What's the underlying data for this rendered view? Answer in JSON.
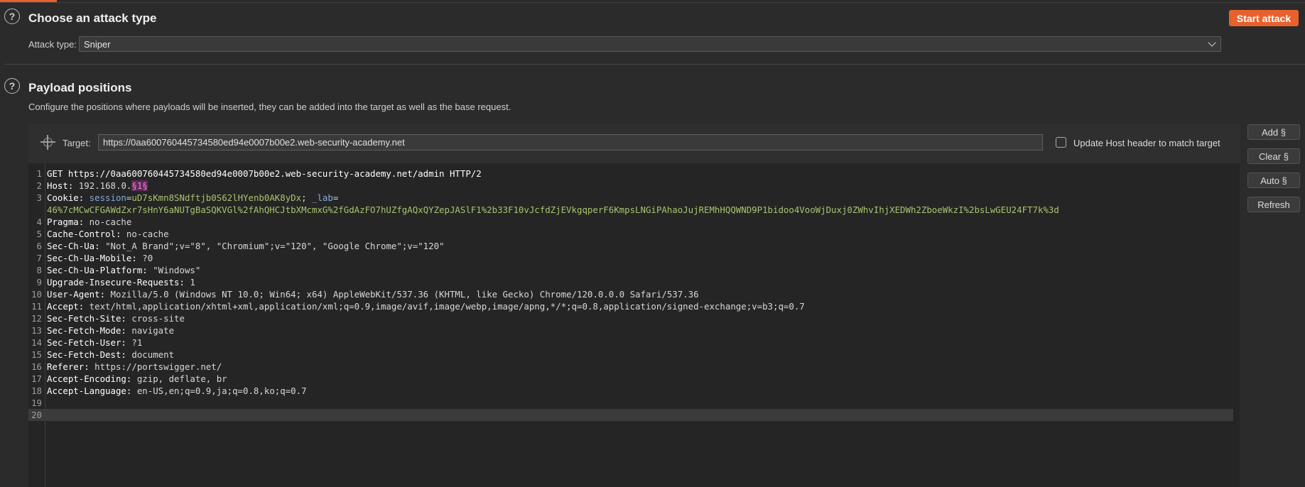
{
  "attack_type_section": {
    "title": "Choose an attack type",
    "attack_type_label": "Attack type:",
    "attack_type_value": "Sniper",
    "start_button": "Start attack"
  },
  "payload_section": {
    "title": "Payload positions",
    "description": "Configure the positions where payloads will be inserted, they can be added into the target as well as the base request.",
    "target_label": "Target:",
    "target_value": "https://0aa600760445734580ed94e0007b00e2.web-security-academy.net",
    "update_host_label": "Update Host header to match target",
    "side_buttons": [
      "Add §",
      "Clear §",
      "Auto §",
      "Refresh"
    ]
  },
  "request_lines": [
    {
      "n": "1",
      "parts": [
        {
          "t": "GET https://0aa600760445734580ed94e0007b00e2.web-security-academy.net/admin HTTP/2",
          "c": "k"
        }
      ]
    },
    {
      "n": "2",
      "parts": [
        {
          "t": "Host:",
          "c": "k"
        },
        {
          "t": " 192.168.0.",
          "c": "v"
        },
        {
          "t": "§1§",
          "c": "mark"
        }
      ]
    },
    {
      "n": "3",
      "parts": [
        {
          "t": "Cookie:",
          "c": "k"
        },
        {
          "t": " session",
          "c": "ck"
        },
        {
          "t": "=",
          "c": "v"
        },
        {
          "t": "uD7sKmn8SNdftjb0S62lHYenb0AK8yDx",
          "c": "cv"
        },
        {
          "t": "; ",
          "c": "v"
        },
        {
          "t": "_lab",
          "c": "ck"
        },
        {
          "t": "=",
          "c": "v"
        }
      ]
    },
    {
      "n": "",
      "parts": [
        {
          "t": "46%7cMCwCFGAWdZxr7sHnY6aNUTgBaSQKVGl%2fAhQHCJtbXMcmxG%2fGdAzFO7hUZfgAQxQYZepJASlF1%2b33F10vJcfdZjEVkgqperF6KmpsLNGiPAhaoJujREMhHQQWND9P1bidoo4VooWjDuxj0ZWhvIhjXEDWh2ZboeWkzI%2bsLwGEU24FT7k%3d",
          "c": "cv"
        }
      ]
    },
    {
      "n": "4",
      "parts": [
        {
          "t": "Pragma:",
          "c": "k"
        },
        {
          "t": " no-cache",
          "c": "v"
        }
      ]
    },
    {
      "n": "5",
      "parts": [
        {
          "t": "Cache-Control:",
          "c": "k"
        },
        {
          "t": " no-cache",
          "c": "v"
        }
      ]
    },
    {
      "n": "6",
      "parts": [
        {
          "t": "Sec-Ch-Ua:",
          "c": "k"
        },
        {
          "t": " \"Not_A Brand\";v=\"8\", \"Chromium\";v=\"120\", \"Google Chrome\";v=\"120\"",
          "c": "v"
        }
      ]
    },
    {
      "n": "7",
      "parts": [
        {
          "t": "Sec-Ch-Ua-Mobile:",
          "c": "k"
        },
        {
          "t": " ?0",
          "c": "v"
        }
      ]
    },
    {
      "n": "8",
      "parts": [
        {
          "t": "Sec-Ch-Ua-Platform:",
          "c": "k"
        },
        {
          "t": " \"Windows\"",
          "c": "v"
        }
      ]
    },
    {
      "n": "9",
      "parts": [
        {
          "t": "Upgrade-Insecure-Requests:",
          "c": "k"
        },
        {
          "t": " 1",
          "c": "v"
        }
      ]
    },
    {
      "n": "10",
      "parts": [
        {
          "t": "User-Agent:",
          "c": "k"
        },
        {
          "t": " Mozilla/5.0 (Windows NT 10.0; Win64; x64) AppleWebKit/537.36 (KHTML, like Gecko) Chrome/120.0.0.0 Safari/537.36",
          "c": "v"
        }
      ]
    },
    {
      "n": "11",
      "parts": [
        {
          "t": "Accept:",
          "c": "k"
        },
        {
          "t": " text/html,application/xhtml+xml,application/xml;q=0.9,image/avif,image/webp,image/apng,*/*;q=0.8,application/signed-exchange;v=b3;q=0.7",
          "c": "v"
        }
      ]
    },
    {
      "n": "12",
      "parts": [
        {
          "t": "Sec-Fetch-Site:",
          "c": "k"
        },
        {
          "t": " cross-site",
          "c": "v"
        }
      ]
    },
    {
      "n": "13",
      "parts": [
        {
          "t": "Sec-Fetch-Mode:",
          "c": "k"
        },
        {
          "t": " navigate",
          "c": "v"
        }
      ]
    },
    {
      "n": "14",
      "parts": [
        {
          "t": "Sec-Fetch-User:",
          "c": "k"
        },
        {
          "t": " ?1",
          "c": "v"
        }
      ]
    },
    {
      "n": "15",
      "parts": [
        {
          "t": "Sec-Fetch-Dest:",
          "c": "k"
        },
        {
          "t": " document",
          "c": "v"
        }
      ]
    },
    {
      "n": "16",
      "parts": [
        {
          "t": "Referer:",
          "c": "k"
        },
        {
          "t": " https://portswigger.net/",
          "c": "v"
        }
      ]
    },
    {
      "n": "17",
      "parts": [
        {
          "t": "Accept-Encoding:",
          "c": "k"
        },
        {
          "t": " gzip, deflate, br",
          "c": "v"
        }
      ]
    },
    {
      "n": "18",
      "parts": [
        {
          "t": "Accept-Language:",
          "c": "k"
        },
        {
          "t": " en-US,en;q=0.9,ja;q=0.8,ko;q=0.7",
          "c": "v"
        }
      ]
    },
    {
      "n": "19",
      "parts": []
    },
    {
      "n": "20",
      "parts": []
    }
  ],
  "current_line": "20",
  "colors": {
    "accent": "#e8612c",
    "payload_marker": "#ff7adf",
    "cookie_name": "#86a8dd",
    "cookie_value": "#a9c46f"
  },
  "icons": {
    "help": "help-circle-icon",
    "target": "crosshair-icon",
    "dropdown": "chevron-down-icon"
  }
}
